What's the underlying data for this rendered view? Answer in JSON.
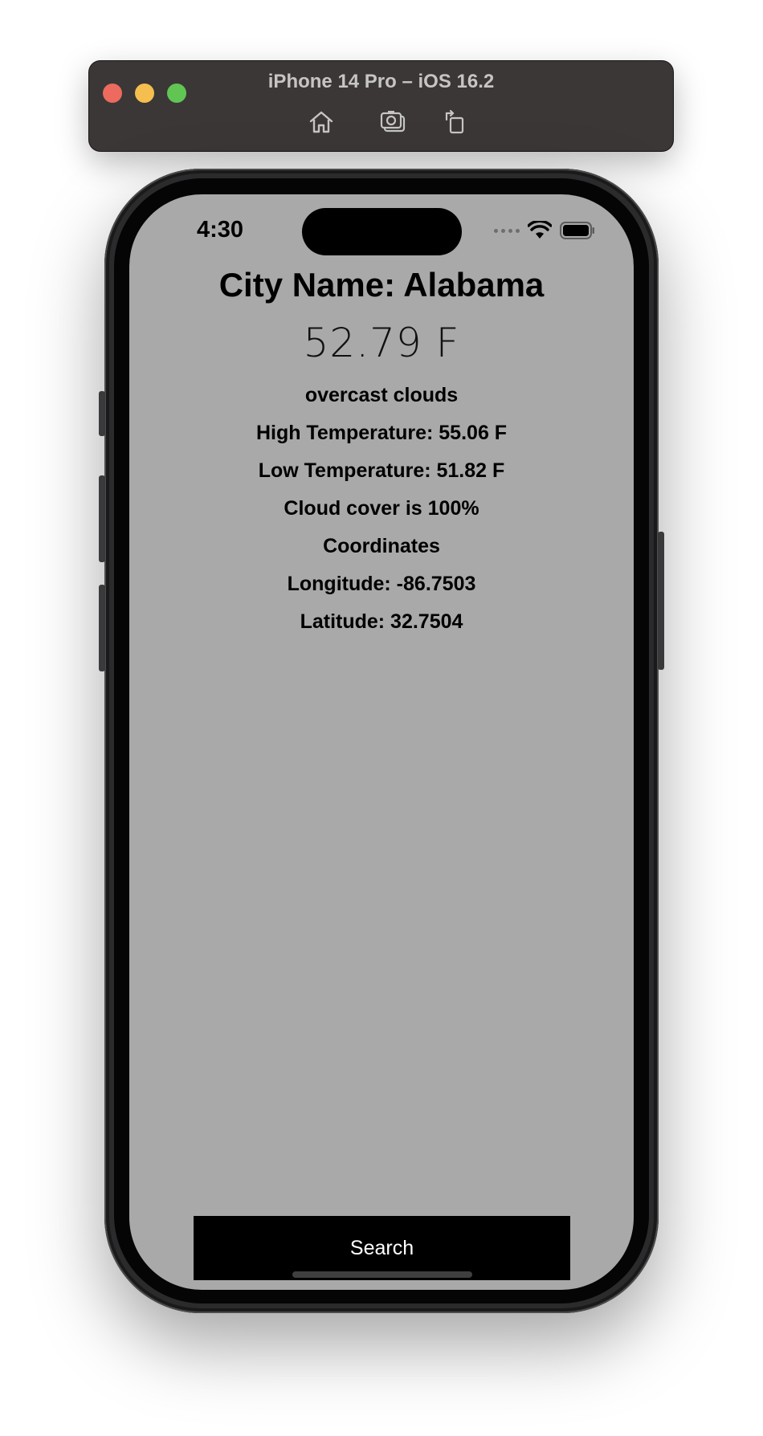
{
  "simulator": {
    "title": "iPhone 14 Pro – iOS 16.2",
    "buttons": [
      "home-icon",
      "screenshot-icon",
      "rotate-icon"
    ],
    "traffic_colors": {
      "close": "#ed6a5e",
      "minimize": "#f5bf4f",
      "maximize": "#61c554"
    }
  },
  "status_bar": {
    "time": "4:30"
  },
  "weather": {
    "city_name": "City Name: Alabama",
    "temperature": "52.79 F",
    "description": "overcast clouds",
    "high": "High Temperature: 55.06 F",
    "low": "Low Temperature: 51.82 F",
    "cloud_cover": "Cloud cover is 100%",
    "coordinates_heading": "Coordinates",
    "longitude": "Longitude: -86.7503",
    "latitude": "Latitude: 32.7504"
  },
  "search_button": {
    "label": "Search"
  },
  "colors": {
    "screen_background": "#a9a9a9",
    "button_background": "#000000",
    "button_text": "#ffffff"
  }
}
